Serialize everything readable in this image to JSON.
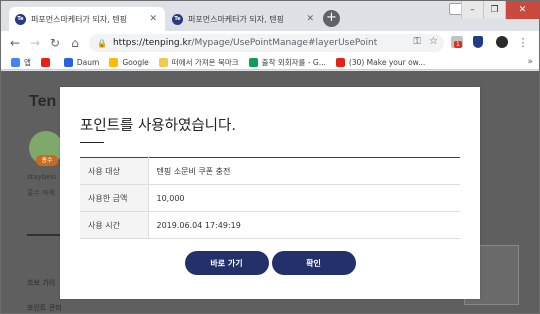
{
  "browser": {
    "tabs": [
      {
        "title": "퍼포먼스마케터가 되자, 텐핑",
        "active": true
      },
      {
        "title": "퍼포먼스마케터가 되자, 텐핑",
        "active": false
      }
    ],
    "new_tab_icon": "plus-icon",
    "url_host": "https://tenping.kr",
    "url_path": "/Mypage/UsePointManage#layerUsePoint",
    "ext_badge": "1",
    "bookmarks": [
      {
        "label": "앱",
        "color": "#4285f4"
      },
      {
        "label": "",
        "color": "#e62117"
      },
      {
        "label": "Daum",
        "color": "#2a62e0"
      },
      {
        "label": "Google",
        "color": "#fbbc05"
      },
      {
        "label": "떠에서 가져온 북마크",
        "color": "#f2c94c"
      },
      {
        "label": "출착 외회자를 - G...",
        "color": "#0f9d58"
      },
      {
        "label": "(30) Make your ow...",
        "color": "#e62117"
      }
    ],
    "bookmarks_more": "»"
  },
  "page": {
    "logo": "Ten",
    "badge": "홍수",
    "side_texts": [
      "staybesi",
      "홍수 마케",
      "초보 가이",
      "포인트 관리"
    ]
  },
  "modal": {
    "title": "포인트를 사용하였습니다.",
    "rows": [
      {
        "label": "사용 대상",
        "value": "텐핑 소문비 쿠폰 충전"
      },
      {
        "label": "사용한 금액",
        "value": "10,000"
      },
      {
        "label": "사용 시간",
        "value": "2019.06.04 17:49:19"
      }
    ],
    "back_button": "바로 가기",
    "confirm_button": "확인",
    "button_color": "#23306a"
  }
}
